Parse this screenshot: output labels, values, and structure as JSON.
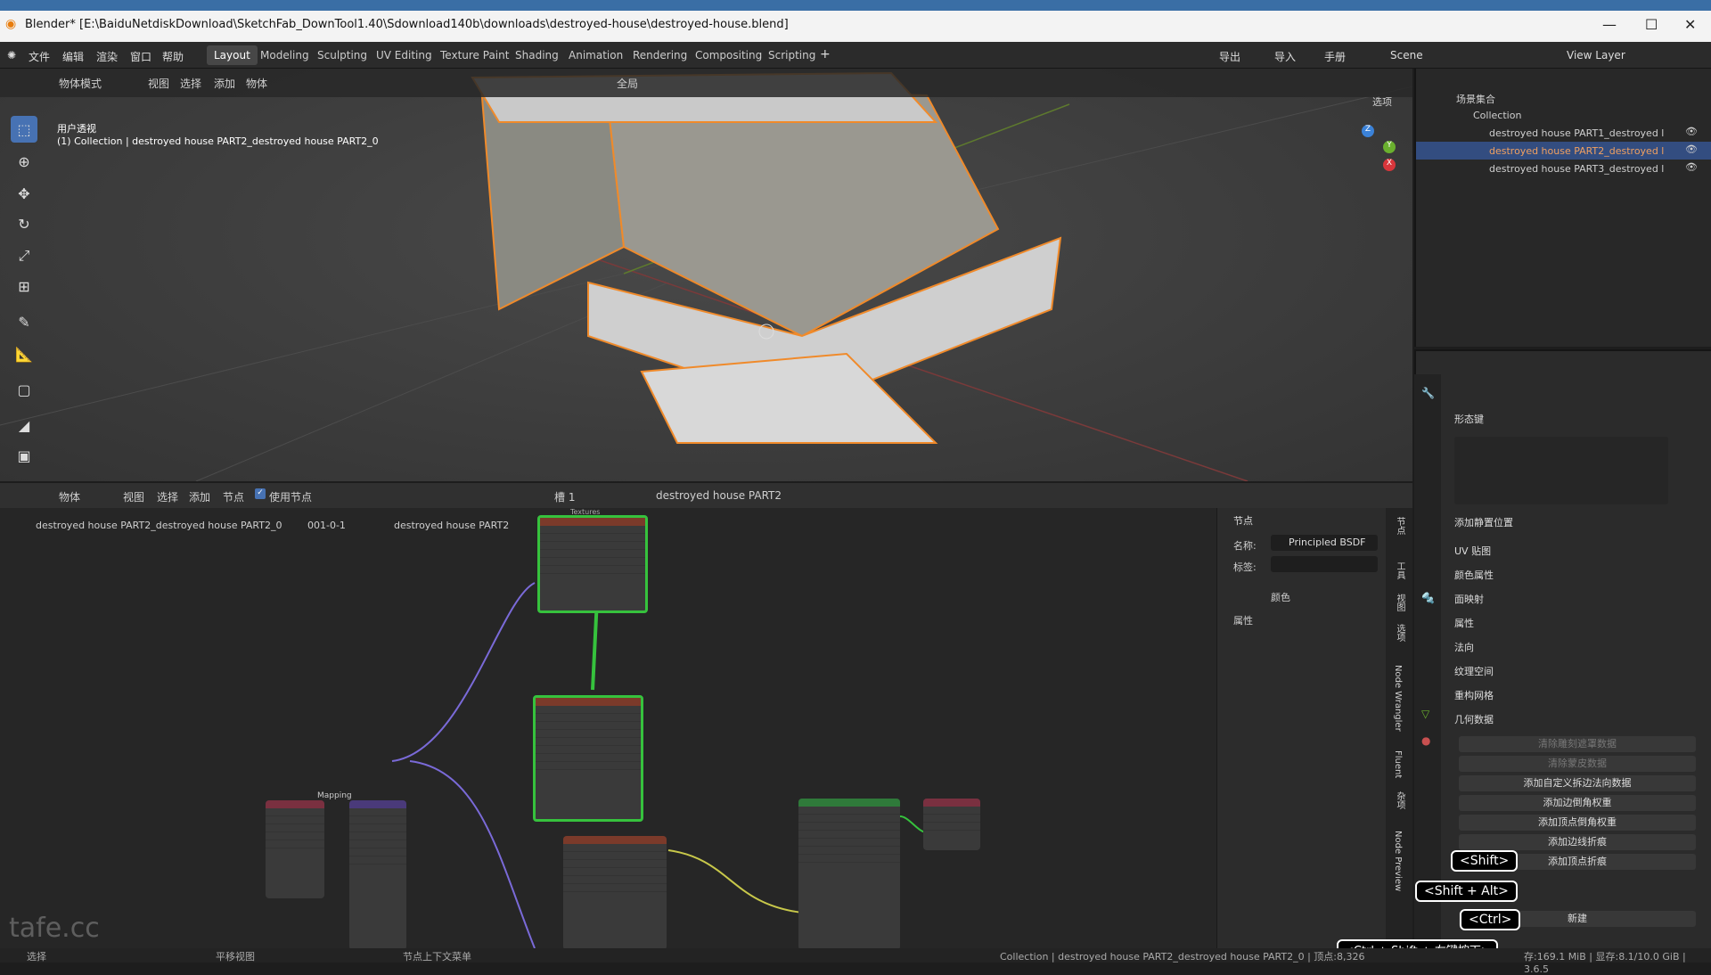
{
  "window": {
    "title": "Blender* [E:\\BaiduNetdiskDownload\\SketchFab_DownTool1.40\\Sdownload140b\\downloads\\destroyed-house\\destroyed-house.blend]"
  },
  "menu": {
    "items": [
      "文件",
      "编辑",
      "渲染",
      "窗口",
      "帮助"
    ]
  },
  "workspaces": [
    "Layout",
    "Modeling",
    "Sculpting",
    "UV Editing",
    "Texture Paint",
    "Shading",
    "Animation",
    "Rendering",
    "Compositing",
    "Scripting"
  ],
  "topright": {
    "export": "导出",
    "import": "导入",
    "manual": "手册",
    "scene": "Scene",
    "view_layer": "View Layer"
  },
  "viewport": {
    "mode": "物体模式",
    "menus": [
      "视图",
      "选择",
      "添加",
      "物体"
    ],
    "transform": "全局",
    "options": "选项",
    "view_name": "用户透视",
    "collection_info": "(1) Collection | destroyed house PART2_destroyed house PART2_0"
  },
  "outliner": {
    "root": "场景集合",
    "collection": "Collection",
    "objects": [
      "destroyed house PART1_destroyed l",
      "destroyed house PART2_destroyed l",
      "destroyed house PART3_destroyed l"
    ]
  },
  "node_editor": {
    "mode": "物体",
    "menus": [
      "视图",
      "选择",
      "添加",
      "节点"
    ],
    "use_nodes": "使用节点",
    "slot": "槽 1",
    "material": "destroyed house PART2",
    "breadcrumb": [
      "destroyed house PART2_destroyed house PART2_0",
      "001-0-1",
      "destroyed house PART2"
    ],
    "frame_texture": "Textures",
    "frame_mapping": "Mapping"
  },
  "node_panel": {
    "header": "节点",
    "name_label": "名称:",
    "name_value": "Principled BSDF",
    "label_label": "标签:",
    "color": "颜色",
    "properties": "属性"
  },
  "vertical_tabs": [
    "节点",
    "工具",
    "视图",
    "选项",
    "Node Wrangler",
    "Fluent",
    "杂项",
    "Node Preview"
  ],
  "properties": {
    "shape_keys": "形态键",
    "add_rest": "添加静置位置",
    "sections": [
      "UV 贴图",
      "颜色属性",
      "面映射",
      "属性",
      "法向",
      "纹理空间",
      "重构网格",
      "几何数据"
    ],
    "buttons_disabled": [
      "清除雕刻遮罩数据",
      "清除蒙皮数据"
    ],
    "buttons": [
      "添加自定义拆边法向数据",
      "添加边倒角权重",
      "添加顶点倒角权重",
      "添加边线折痕",
      "添加顶点折痕"
    ],
    "new": "新建"
  },
  "keys": [
    "<Shift>",
    "<Shift + Alt>",
    "<Ctrl>",
    "<Ctrl + Shift + 右键按下>"
  ],
  "status": {
    "left": "选择",
    "mid": "平移视图",
    "mid2": "节点上下文菜单",
    "right": "Collection | destroyed house PART2_destroyed house PART2_0 | 顶点:8,326",
    "mem": "存:169.1 MiB | 显存:8.1/10.0 GiB | 3.6.5"
  },
  "watermark": "tafe.cc"
}
